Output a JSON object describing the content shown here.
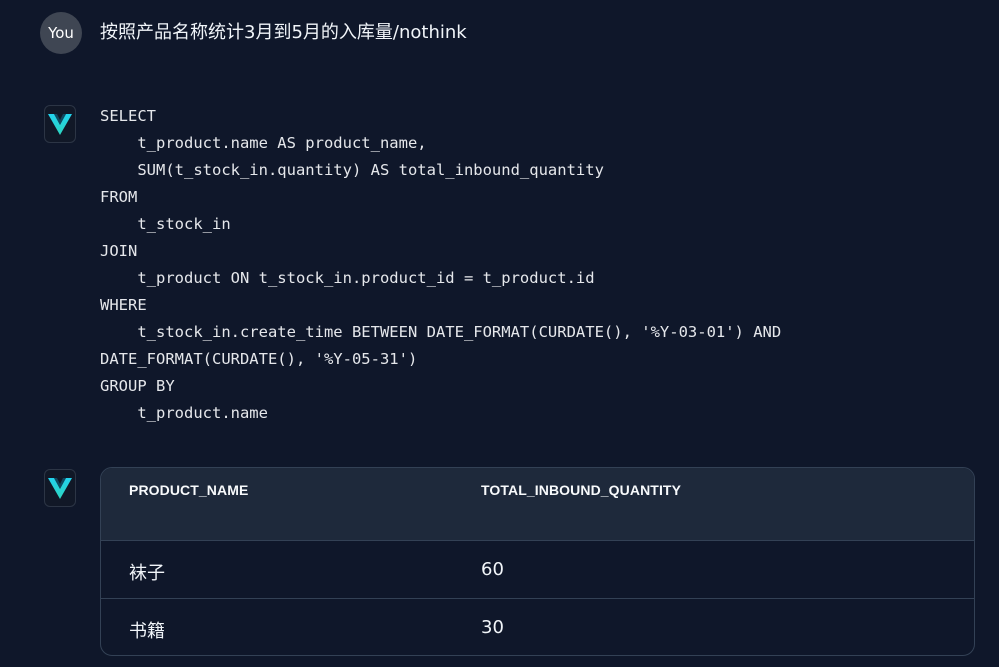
{
  "user": {
    "avatar_label": "You",
    "message": "按照产品名称统计3月到5月的入库量/nothink"
  },
  "assistant": {
    "avatar_icon": "v-logo-icon",
    "accent_colors": [
      "#22d3ee",
      "#2dd4bf"
    ],
    "sql_lines": [
      "SELECT",
      "    t_product.name AS product_name,",
      "    SUM(t_stock_in.quantity) AS total_inbound_quantity",
      "FROM",
      "    t_stock_in",
      "JOIN",
      "    t_product ON t_stock_in.product_id = t_product.id",
      "WHERE",
      "    t_stock_in.create_time BETWEEN DATE_FORMAT(CURDATE(), '%Y-03-01') AND",
      "DATE_FORMAT(CURDATE(), '%Y-05-31')",
      "GROUP BY",
      "    t_product.name"
    ]
  },
  "result_table": {
    "columns": [
      "PRODUCT_NAME",
      "TOTAL_INBOUND_QUANTITY"
    ],
    "rows": [
      [
        "袜子",
        "60"
      ],
      [
        "书籍",
        "30"
      ]
    ]
  }
}
